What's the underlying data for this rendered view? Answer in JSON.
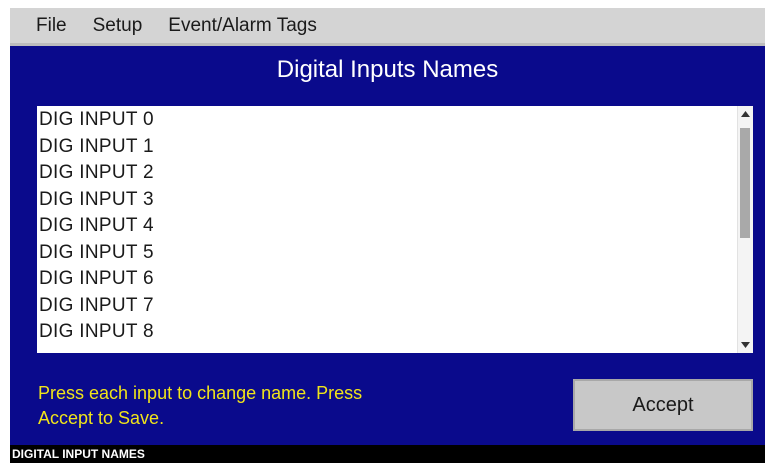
{
  "menu": {
    "items": [
      {
        "label": "File"
      },
      {
        "label": "Setup"
      },
      {
        "label": "Event/Alarm Tags"
      }
    ]
  },
  "panel": {
    "title": "Digital Inputs Names",
    "inputs": [
      "DIG INPUT 0",
      "DIG INPUT 1",
      "DIG INPUT 2",
      "DIG INPUT 3",
      "DIG INPUT 4",
      "DIG INPUT 5",
      "DIG INPUT 6",
      "DIG INPUT 7",
      "DIG INPUT 8"
    ],
    "instructions_line1": "Press each input to change name. Press",
    "instructions_line2": "Accept to Save.",
    "accept_label": "Accept"
  },
  "status": {
    "text": "DIGITAL INPUT NAMES"
  },
  "colors": {
    "panel_bg": "#0a0a8c",
    "instruction_text": "#f0e41a",
    "menubar_bg": "#d4d4d4"
  },
  "icons": {
    "scroll_up": "arrow-up-icon",
    "scroll_down": "arrow-down-icon"
  }
}
